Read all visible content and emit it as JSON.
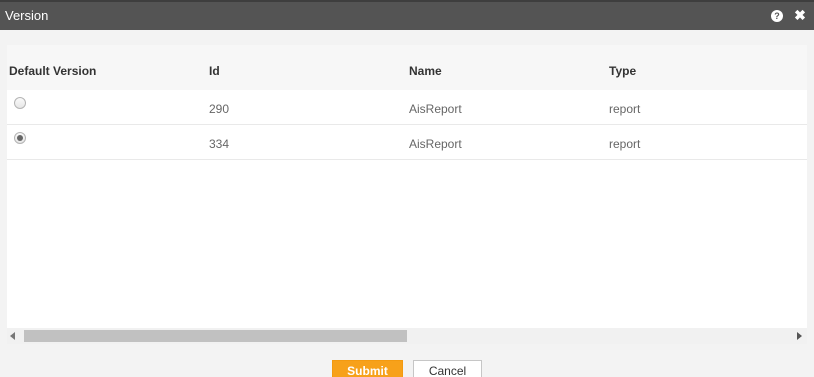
{
  "dialog": {
    "title": "Version",
    "help_icon": "?",
    "close_icon": "✖"
  },
  "table": {
    "headers": {
      "default_version": "Default Version",
      "id": "Id",
      "name": "Name",
      "type": "Type"
    },
    "rows": [
      {
        "id": "290",
        "name": "AisReport",
        "type": "report",
        "selected": false
      },
      {
        "id": "334",
        "name": "AisReport",
        "type": "report",
        "selected": true
      }
    ]
  },
  "scrollbar": {
    "position": 0
  },
  "buttons": {
    "submit": "Submit",
    "cancel": "Cancel"
  },
  "colors": {
    "titlebar": "#545454",
    "submit": "#f7a11a"
  }
}
